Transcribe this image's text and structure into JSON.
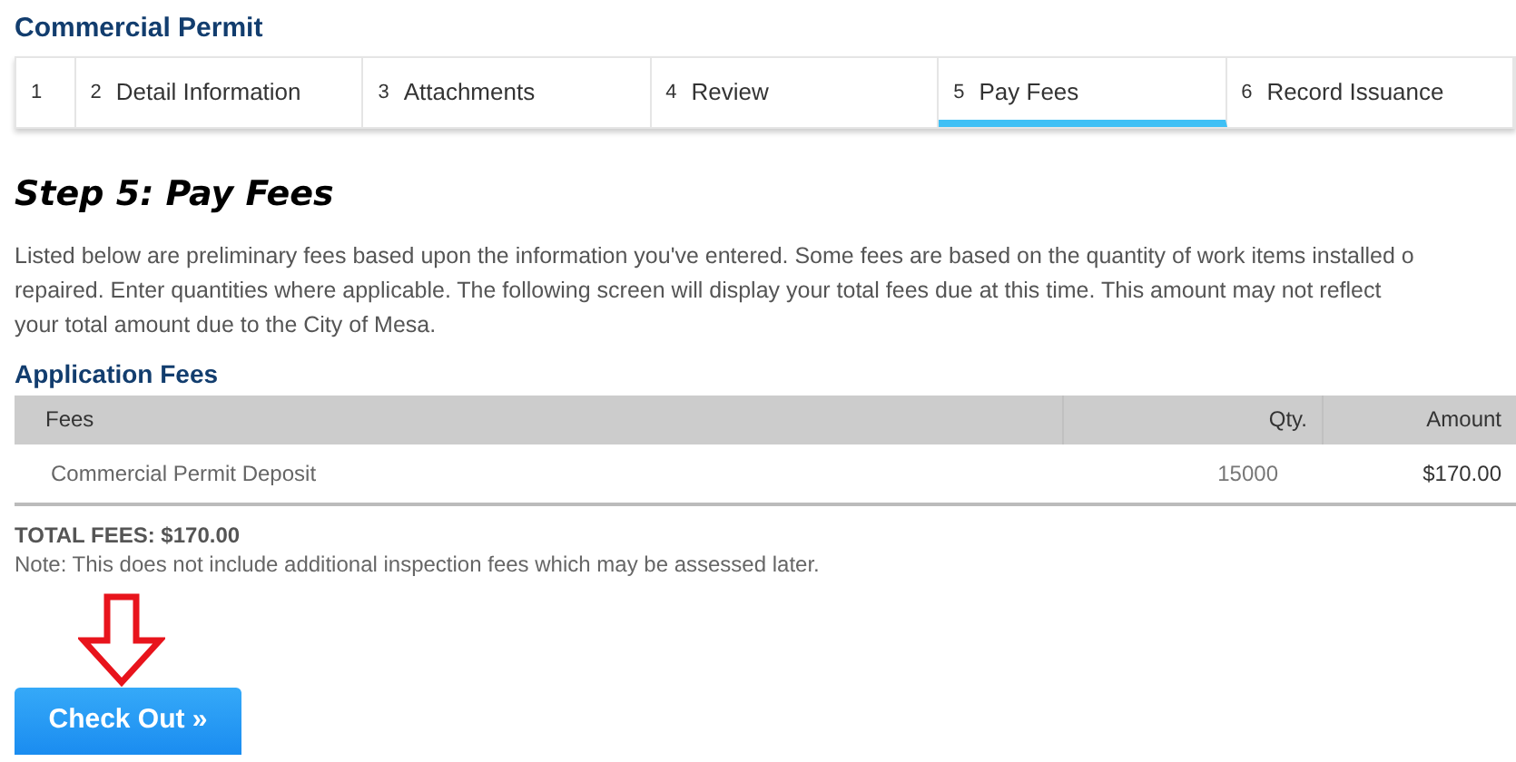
{
  "title": "Commercial Permit",
  "steps": [
    {
      "number": "1",
      "selected": false
    },
    {
      "number": "2",
      "label": "Detail Information",
      "selected": false
    },
    {
      "number": "3",
      "label": "Attachments",
      "selected": false
    },
    {
      "number": "4",
      "label": "Review",
      "selected": false
    },
    {
      "number": "5",
      "label": "Pay Fees",
      "selected": true
    },
    {
      "number": "6",
      "label": "Record Issuance",
      "selected": false
    }
  ],
  "step_heading": "Step 5: Pay Fees",
  "intro_lines": [
    "Listed below are preliminary fees based upon the information you've entered. Some fees are based on the quantity of work items installed o",
    "repaired. Enter quantities where applicable. The following screen will display your total fees due at this time. This amount may not reflect",
    "your total amount due to the City of Mesa."
  ],
  "section_title": "Application Fees",
  "table": {
    "columns": [
      "Fees",
      "Qty.",
      "Amount"
    ],
    "rows": [
      [
        "Commercial Permit Deposit",
        "15000",
        "$170.00"
      ]
    ]
  },
  "total": "TOTAL FEES: $170.00",
  "note": "Note: This does not include additional inspection fees which may be assessed later.",
  "checkout_button": "Check Out »"
}
